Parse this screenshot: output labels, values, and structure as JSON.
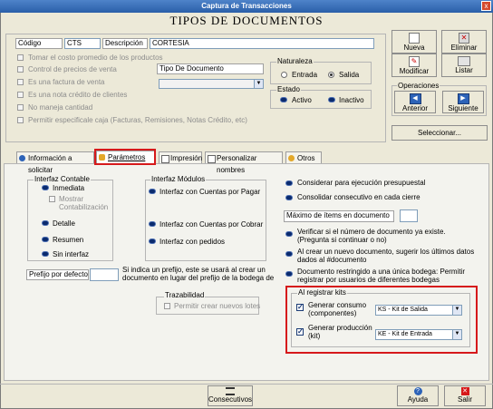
{
  "window": {
    "title": "Captura de Transacciones",
    "close_label": "x"
  },
  "document_title": "TIPOS DE DOCUMENTOS",
  "header": {
    "codigo_label": "Código",
    "codigo_value": "CTS",
    "descripcion_label": "Descripción",
    "descripcion_value": "CORTESIA",
    "tipo_documento_value": "Tipo De Documento",
    "options": [
      "Tomar el costo promedio de los productos",
      "Control de precios de venta",
      "Es una factura de venta",
      "Es una nota crédito de clientes",
      "No maneja cantidad",
      "Permitir especificale caja  (Facturas, Remisiones, Notas Crédito, etc)"
    ],
    "naturaleza": {
      "legend": "Naturaleza",
      "entrada": "Entrada",
      "salida": "Salida",
      "selected": "Salida"
    },
    "estado": {
      "legend": "Estado",
      "activo": "Activo",
      "inactivo": "Inactivo"
    }
  },
  "toolbar": {
    "nueva": "Nueva",
    "eliminar": "Eliminar",
    "modificar": "Modificar",
    "listar": "Listar",
    "operaciones_legend": "Operaciones",
    "anterior": "Anterior",
    "siguiente": "Siguiente",
    "seleccionar": "Seleccionar..."
  },
  "tabs": [
    {
      "label": "Información a solicitar"
    },
    {
      "label": "Parámetros"
    },
    {
      "label": "Impresión"
    },
    {
      "label": "Personalizar nombres"
    },
    {
      "label": "Otros"
    }
  ],
  "interfaz_contable": {
    "legend": "Interfaz Contable",
    "inmediata": "Inmediata",
    "mostrar": "Mostrar",
    "contabilizacion": "Contabilización",
    "detalle": "Detalle",
    "resumen": "Resumen",
    "sin_interfaz": "Sin interfaz"
  },
  "interfaz_modulos": {
    "legend": "Interfaz Módulos",
    "items": [
      "Interfaz con Cuentas por Pagar",
      "Interfaz con Cuentas por Cobrar",
      "Interfaz con pedidos"
    ]
  },
  "prefijo": {
    "label": "Prefijo por defecto",
    "value": "",
    "note_line1": "Si indica un prefijo, este se usará al crear un",
    "note_line2": "documento en lugar del prefijo de la bodega de"
  },
  "trazabilidad": {
    "legend": "Trazabilidad",
    "option": "Permitir crear nuevos lotes"
  },
  "right_options": {
    "presupuestal": "Considerar para ejecución presupuestal",
    "consolidar": "Consolidar consecutivo en cada cierre",
    "maximo_label": "Máximo de ítems en documento",
    "maximo_value": "",
    "verificar_line1": "Verificar si el número de documento ya existe.",
    "verificar_line2": "(Pregunta si continuar o no)",
    "sugerir_line1": "Al crear un nuevo documento, sugerir los últimos datos",
    "sugerir_line2": "dados al #documento",
    "restringido_line1": "Documento restringido a una única bodega: Permitir",
    "restringido_line2": "registrar por usuarios de diferentes bodegas"
  },
  "kits": {
    "legend": "Al registrar kits",
    "consumo_line1": "Generar consumo",
    "consumo_line2": "(componentes)",
    "consumo_value": "KS - Kit de Salida",
    "produccion_line1": "Generar producción",
    "produccion_line2": "(kit)",
    "produccion_value": "KE - Kit de Entrada"
  },
  "footer": {
    "consecutivos": "Consecutivos",
    "ayuda": "Ayuda",
    "salir": "Salir"
  },
  "colors": {
    "highlight": "#d6191b",
    "titlebar": "#2a5fa9"
  }
}
